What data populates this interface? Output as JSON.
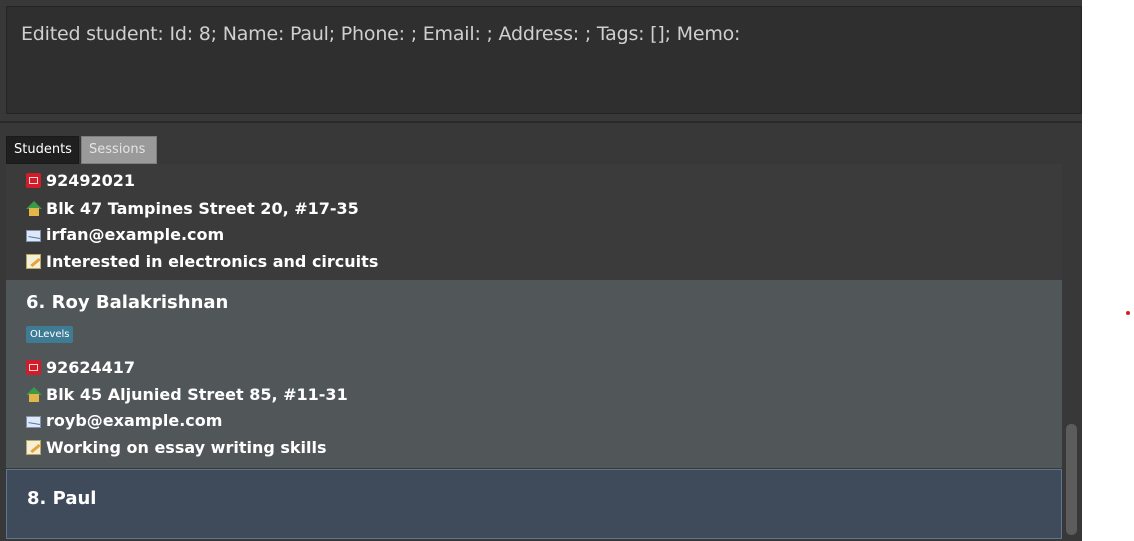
{
  "result_display": {
    "text": "Edited student: Id: 8; Name: Paul; Phone: ; Email: ; Address: ; Tags: []; Memo:"
  },
  "tabs": [
    {
      "label": "Students",
      "active": true
    },
    {
      "label": "Sessions",
      "active": false
    }
  ],
  "students": [
    {
      "phone": "92492021",
      "address": "Blk 47 Tampines Street 20, #17-35",
      "email": "irfan@example.com",
      "memo": "Interested in electronics and circuits"
    },
    {
      "name": "6. Roy Balakrishnan",
      "tags": [
        "OLevels"
      ],
      "phone": "92624417",
      "address": "Blk 45 Aljunied Street 85, #11-31",
      "email": "royb@example.com",
      "memo": "Working on essay writing skills"
    },
    {
      "name": "8. Paul"
    }
  ],
  "icons": {
    "phone": "phone-icon",
    "address": "home-icon",
    "email": "mail-icon",
    "memo": "memo-icon"
  },
  "colors": {
    "tag_background": "#3e7c96",
    "selected_card": "#3f4a5b",
    "phone_icon": "#d11d2b"
  }
}
